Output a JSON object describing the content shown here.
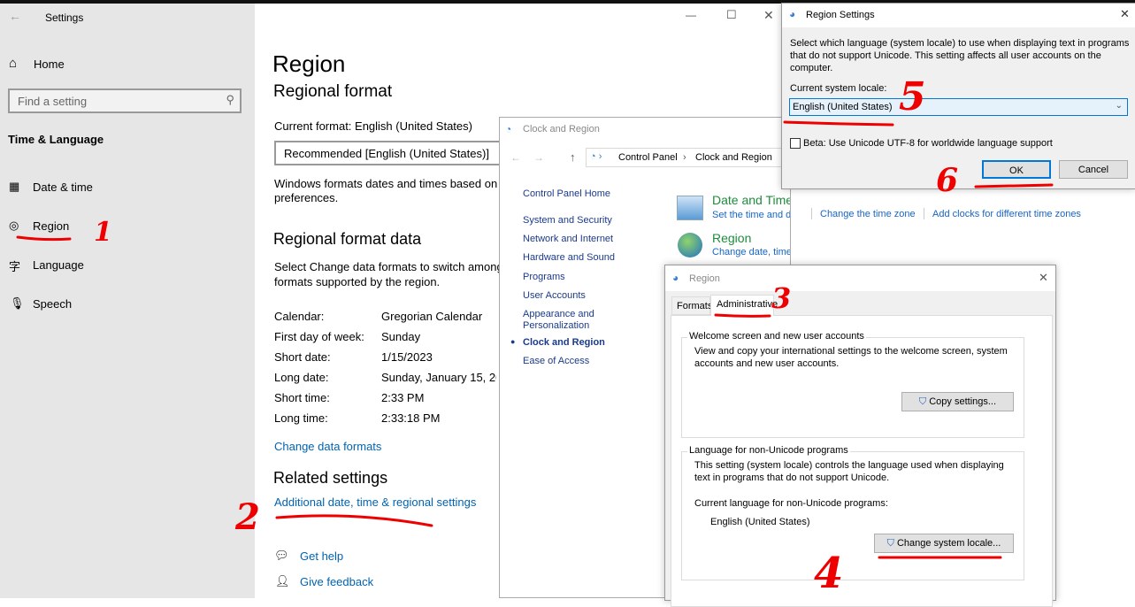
{
  "settings": {
    "title": "Settings",
    "home": "Home",
    "search_placeholder": "Find a setting",
    "section": "Time & Language",
    "nav": [
      {
        "label": "Date & time",
        "icon": "calendar-clock-icon"
      },
      {
        "label": "Region",
        "icon": "globe-icon",
        "selected": true
      },
      {
        "label": "Language",
        "icon": "language-icon"
      },
      {
        "label": "Speech",
        "icon": "microphone-icon"
      }
    ],
    "page_title": "Region",
    "regional_format": "Regional format",
    "current_format": "Current format: English (United States)",
    "format_dropdown": "Recommended [English (United States)]",
    "format_desc_1": "Windows formats dates and times based on y",
    "format_desc_2": "preferences.",
    "format_data_title": "Regional format data",
    "format_data_desc_1": "Select Change data formats to switch among",
    "format_data_desc_2": "formats supported by the region.",
    "rows": [
      {
        "label": "Calendar:",
        "value": "Gregorian Calendar"
      },
      {
        "label": "First day of week:",
        "value": "Sunday"
      },
      {
        "label": "Short date:",
        "value": "1/15/2023"
      },
      {
        "label": "Long date:",
        "value": "Sunday, January 15, 202"
      },
      {
        "label": "Short time:",
        "value": "2:33 PM"
      },
      {
        "label": "Long time:",
        "value": "2:33:18 PM"
      }
    ],
    "change_data_formats": "Change data formats",
    "related_title": "Related settings",
    "additional_link": "Additional date, time & regional settings",
    "get_help": "Get help",
    "give_feedback": "Give feedback"
  },
  "control_panel": {
    "title": "Clock and Region",
    "breadcrumb": [
      "Control Panel",
      "Clock and Region"
    ],
    "left_links": [
      "Control Panel Home",
      "System and Security",
      "Network and Internet",
      "Hardware and Sound",
      "Programs",
      "User Accounts",
      "Appearance and",
      "Personalization",
      "Clock and Region",
      "Ease of Access"
    ],
    "date_time": {
      "heading": "Date and Time",
      "links": [
        "Set the time and date",
        "Change the time zone",
        "Add clocks for different time zones"
      ]
    },
    "region": {
      "heading": "Region",
      "link": "Change date, time, or number formats"
    }
  },
  "region_dialog": {
    "title": "Region",
    "tabs": [
      "Formats",
      "Administrative"
    ],
    "active_tab": "Administrative",
    "group1_title": "Welcome screen and new user accounts",
    "group1_text_1": "View and copy your international settings to the welcome screen, system",
    "group1_text_2": "accounts and new user accounts.",
    "copy_button": "Copy settings...",
    "group2_title": "Language for non-Unicode programs",
    "group2_text_1": "This setting (system locale) controls the language used when displaying",
    "group2_text_2": "text in programs that do not support Unicode.",
    "current_label": "Current language for non-Unicode programs:",
    "current_value": "English (United States)",
    "change_button": "Change system locale..."
  },
  "region_settings": {
    "title": "Region Settings",
    "desc_1": "Select which language (system locale) to use when displaying text in programs",
    "desc_2": "that do not support Unicode. This setting affects all user accounts on the",
    "desc_3": "computer.",
    "locale_label": "Current system locale:",
    "locale_value": "English (United States)",
    "beta_label": "Beta: Use Unicode UTF-8 for worldwide language support",
    "beta_checked": false,
    "ok": "OK",
    "cancel": "Cancel"
  },
  "annotations": {
    "color": "#e00000",
    "steps": [
      "1",
      "2",
      "3",
      "4",
      "5",
      "6"
    ]
  }
}
